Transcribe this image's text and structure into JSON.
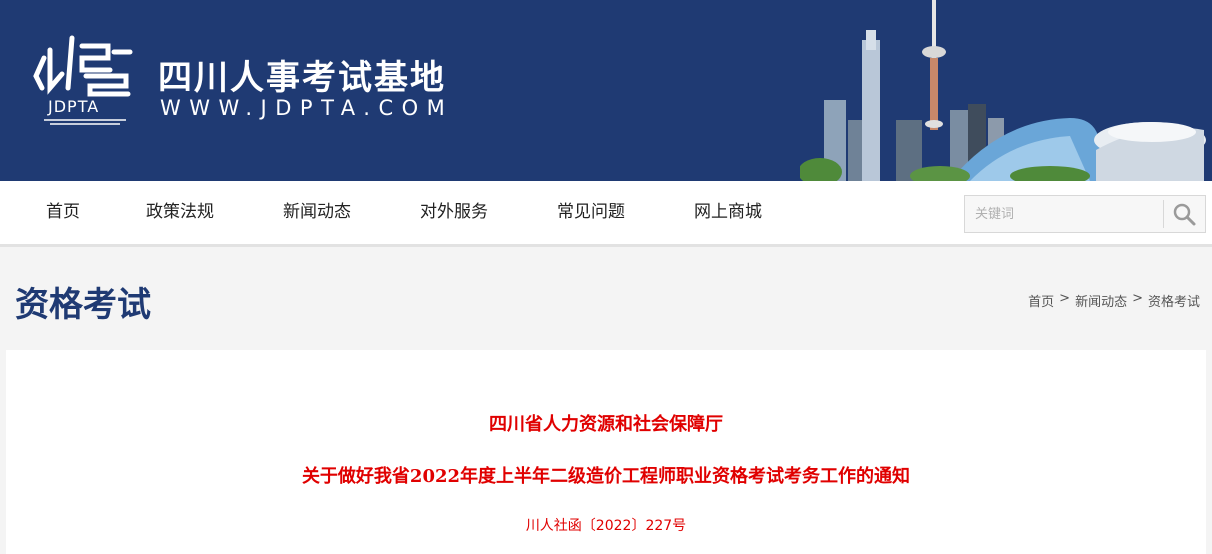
{
  "header": {
    "logo_text": "JDPTA",
    "site_title": "四川人事考试基地",
    "site_url": "WWW.JDPTA.COM",
    "bg_color": "#1f3a73"
  },
  "nav": {
    "items": [
      {
        "label": "首页"
      },
      {
        "label": "政策法规"
      },
      {
        "label": "新闻动态"
      },
      {
        "label": "对外服务"
      },
      {
        "label": "常见问题"
      },
      {
        "label": "网上商城"
      }
    ],
    "search": {
      "placeholder": "关键词",
      "icon": "search-icon"
    }
  },
  "page": {
    "title": "资格考试",
    "breadcrumb": [
      "首页",
      "新闻动态",
      "资格考试"
    ],
    "separator": ">"
  },
  "article": {
    "org": "四川省人力资源和社会保障厅",
    "headline": "关于做好我省2022年度上半年二级造价工程师职业资格考试考务工作的通知",
    "doc_no": "川人社函〔2022〕227号",
    "accent_color": "#e00000"
  }
}
